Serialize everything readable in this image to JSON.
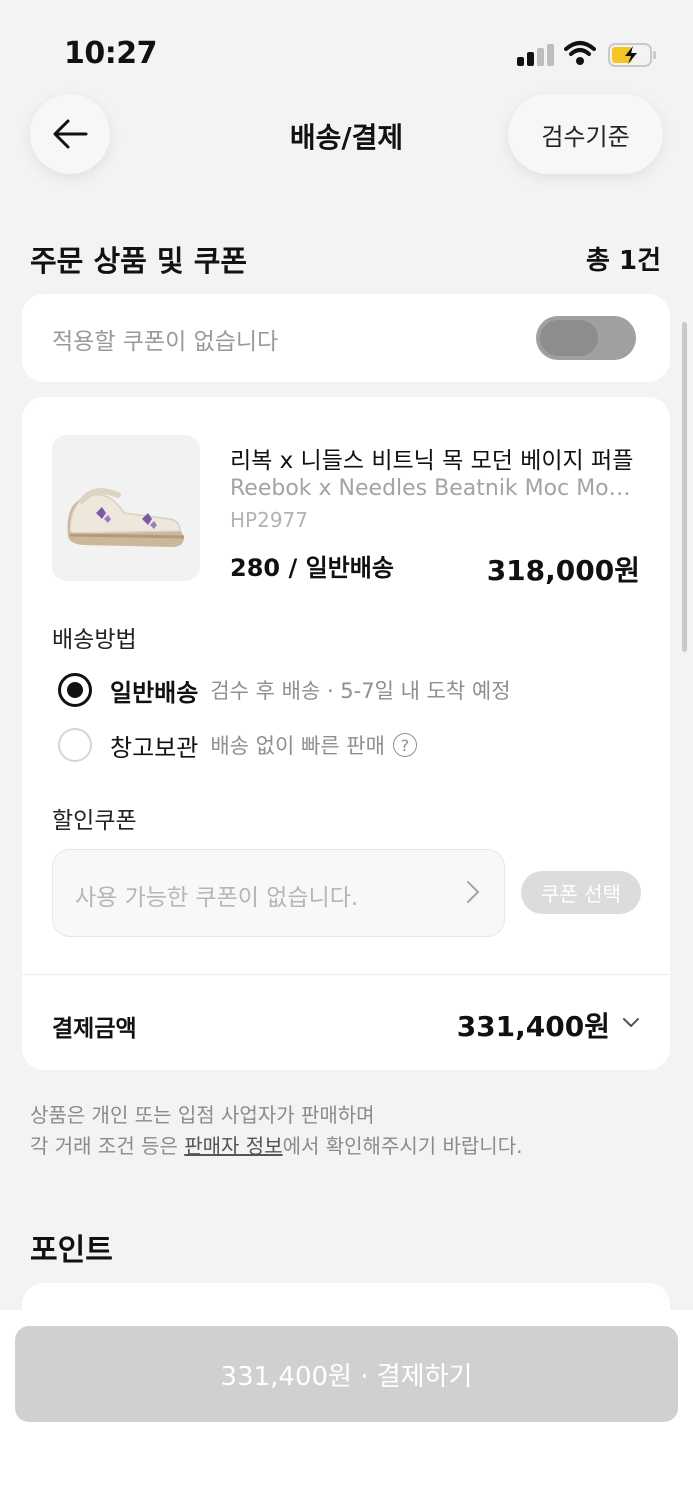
{
  "status": {
    "time": "10:27"
  },
  "header": {
    "title": "배송/결제",
    "criteria_label": "검수기준"
  },
  "order_section": {
    "title": "주문 상품 및 쿠폰",
    "count": "총 1건"
  },
  "coupon_toggle": {
    "text": "적용할 쿠폰이 없습니다",
    "enabled": false
  },
  "product": {
    "name_ko": "리복 x 니들스 비트닉 목 모던 베이지 퍼플",
    "name_en": "Reebok x Needles Beatnik Moc Modern Beige Purple",
    "code": "HP2977",
    "option": "280 / 일반배송",
    "price": "318,000원"
  },
  "delivery": {
    "label": "배송방법",
    "options": [
      {
        "label": "일반배송",
        "desc": "검수 후 배송 · 5-7일 내 도착 예정",
        "selected": true
      },
      {
        "label": "창고보관",
        "desc": "배송 없이 빠른 판매",
        "help": "?",
        "selected": false
      }
    ]
  },
  "discount": {
    "label": "할인쿠폰",
    "placeholder": "사용 가능한 쿠폰이 없습니다.",
    "select_label": "쿠폰 선택"
  },
  "payment": {
    "label": "결제금액",
    "amount": "331,400원"
  },
  "notice": {
    "line1": "상품은 개인 또는 입점 사업자가 판매하며",
    "line2_pre": "각 거래 조건 등은 ",
    "line2_link": "판매자 정보",
    "line2_post": "에서 확인해주시기 바랍니다."
  },
  "points": {
    "title": "포인트"
  },
  "bottom": {
    "pay_label": "331,400원 · 결제하기"
  },
  "colors": {
    "accent": "#111111",
    "disabled_button": "#d0d0d0",
    "background": "#f3f3f5"
  }
}
